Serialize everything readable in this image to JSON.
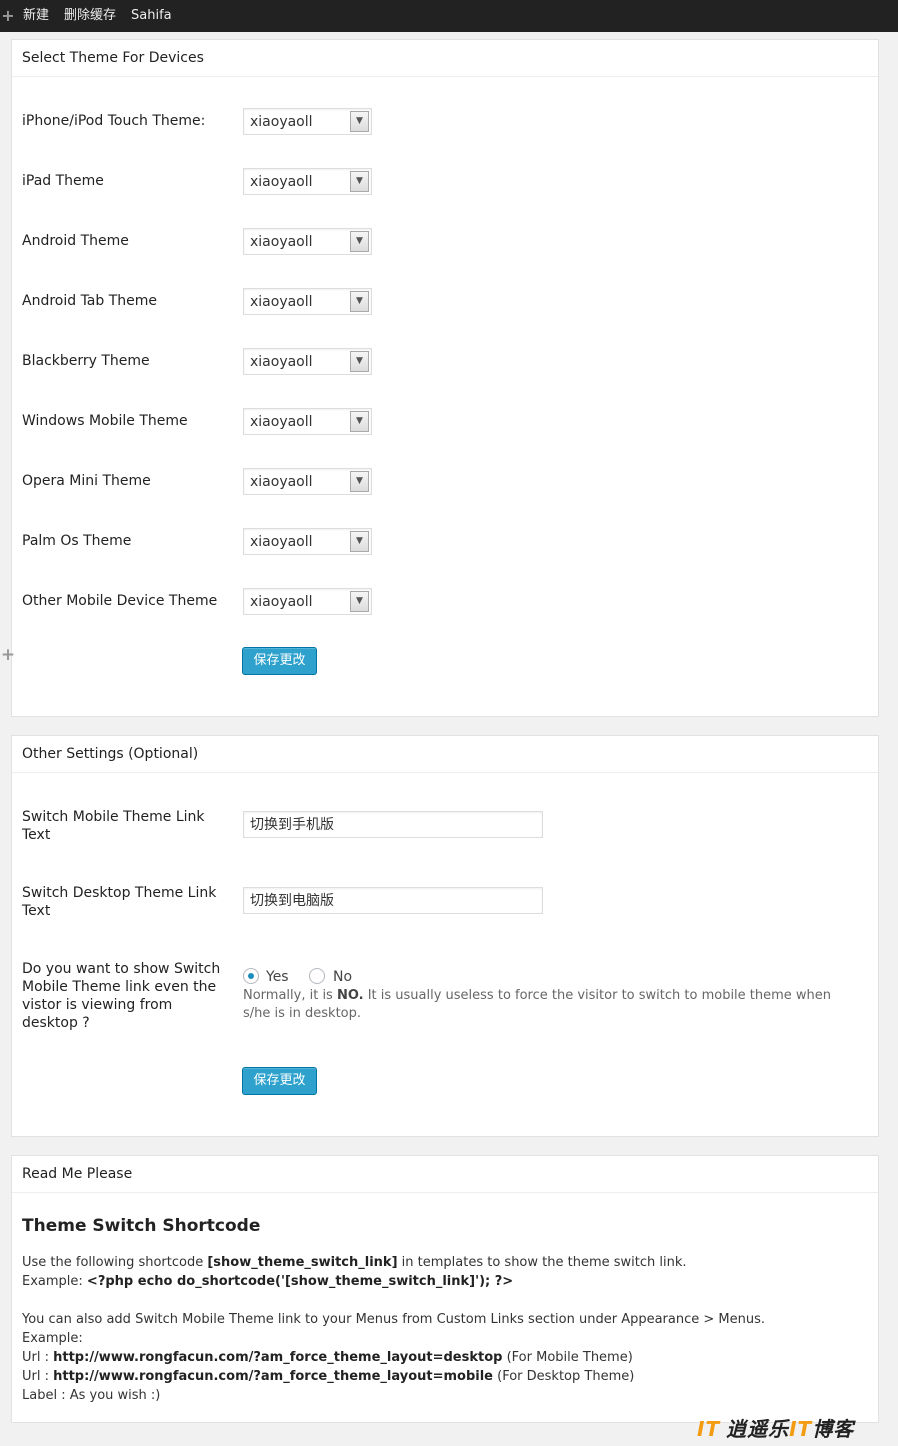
{
  "adminbar": {
    "new_label": "新建",
    "clear_cache_label": "删除缓存",
    "theme_label": "Sahifa"
  },
  "devices_box": {
    "title": "Select Theme For Devices",
    "rows": [
      {
        "label": "iPhone/iPod Touch Theme:",
        "value": "xiaoyaoll"
      },
      {
        "label": "iPad Theme",
        "value": "xiaoyaoll"
      },
      {
        "label": "Android Theme",
        "value": "xiaoyaoll"
      },
      {
        "label": "Android Tab Theme",
        "value": "xiaoyaoll"
      },
      {
        "label": "Blackberry Theme",
        "value": "xiaoyaoll"
      },
      {
        "label": "Windows Mobile Theme",
        "value": "xiaoyaoll"
      },
      {
        "label": "Opera Mini Theme",
        "value": "xiaoyaoll"
      },
      {
        "label": "Palm Os Theme",
        "value": "xiaoyaoll"
      },
      {
        "label": "Other Mobile Device Theme",
        "value": "xiaoyaoll"
      }
    ],
    "save_label": "保存更改"
  },
  "other_box": {
    "title": "Other Settings (Optional)",
    "mobile_link_label": "Switch Mobile Theme Link Text",
    "mobile_link_value": "切换到手机版",
    "desktop_link_label": "Switch Desktop Theme Link Text",
    "desktop_link_value": "切换到电脑版",
    "show_link_label": "Do you want to show Switch Mobile Theme link even the vistor is viewing from desktop ?",
    "yes_label": "Yes",
    "no_label": "No",
    "selected": "Yes",
    "help_prefix": "Normally, it is ",
    "help_bold": "NO.",
    "help_suffix": " It is usually useless to force the visitor to switch to mobile theme when s/he is in desktop.",
    "save_label": "保存更改"
  },
  "readme_box": {
    "title": "Read Me Please",
    "heading": "Theme Switch Shortcode",
    "line1_prefix": "Use the following shortcode ",
    "line1_code": "[show_theme_switch_link]",
    "line1_suffix": " in templates to show the theme switch link.",
    "line2_prefix": "Example: ",
    "line2_code": "<?php echo do_shortcode('[show_theme_switch_link]'); ?>",
    "line3": "You can also add Switch Mobile Theme link to your Menus from Custom Links section under Appearance > Menus.",
    "line4": "Example:",
    "url1_prefix": "Url : ",
    "url1": "http://www.rongfacun.com/?am_force_theme_layout=desktop",
    "url1_suffix": " (For Mobile Theme)",
    "url2_prefix": "Url : ",
    "url2": "http://www.rongfacun.com/?am_force_theme_layout=mobile",
    "url2_suffix": " (For Desktop Theme)",
    "label_line": "Label : As you wish :)"
  },
  "watermark": {
    "logo": "IT",
    "text_a": "逍遥乐",
    "text_it": "IT",
    "text_b": "博客"
  },
  "colors": {
    "adminbar_bg": "#222222",
    "primary_button": "#2ea2cc",
    "radio_checked": "#1e8cbe",
    "watermark_accent": "#f39c12"
  }
}
